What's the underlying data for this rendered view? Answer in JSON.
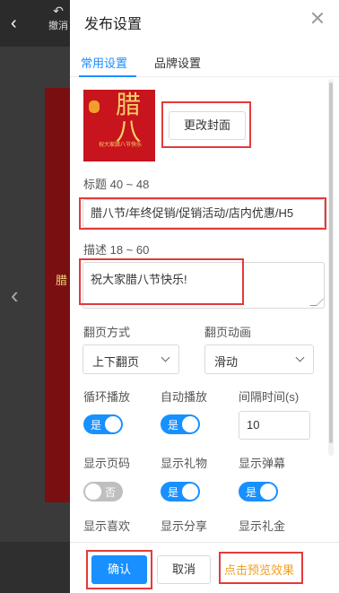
{
  "background": {
    "back_icon": "‹",
    "undo_label": "撤消",
    "canvas_text": "腊"
  },
  "panel": {
    "title": "发布设置",
    "tabs": [
      {
        "label": "常用设置",
        "active": true
      },
      {
        "label": "品牌设置",
        "active": false
      }
    ],
    "cover": {
      "big_text": "腊八",
      "sub_text": "祝大家腊八节快乐",
      "change_button": "更改封面"
    },
    "title_field": {
      "label": "标题 40 ~ 48",
      "value": "腊八节/年终促销/促销活动/店内优惠/H5"
    },
    "desc_field": {
      "label": "描述 18 ~ 60",
      "value": "祝大家腊八节快乐!"
    },
    "page_turn": {
      "label": "翻页方式",
      "value": "上下翻页"
    },
    "page_anim": {
      "label": "翻页动画",
      "value": "滑动"
    },
    "loop": {
      "label": "循环播放",
      "state": "是"
    },
    "autoplay": {
      "label": "自动播放",
      "state": "是"
    },
    "interval": {
      "label": "间隔时间(s)",
      "value": "10"
    },
    "show_page_num": {
      "label": "显示页码",
      "state": "否"
    },
    "show_gift": {
      "label": "显示礼物",
      "state": "是"
    },
    "show_barrage": {
      "label": "显示弹幕",
      "state": "是"
    },
    "show_like": {
      "label": "显示喜欢"
    },
    "show_share": {
      "label": "显示分享"
    },
    "show_money": {
      "label": "显示礼金"
    },
    "footer": {
      "confirm": "确认",
      "cancel": "取消",
      "preview": "点击预览效果"
    }
  },
  "colors": {
    "accent": "#1890ff",
    "highlight_border": "#e33a3a",
    "preview_link": "#f0a020"
  }
}
